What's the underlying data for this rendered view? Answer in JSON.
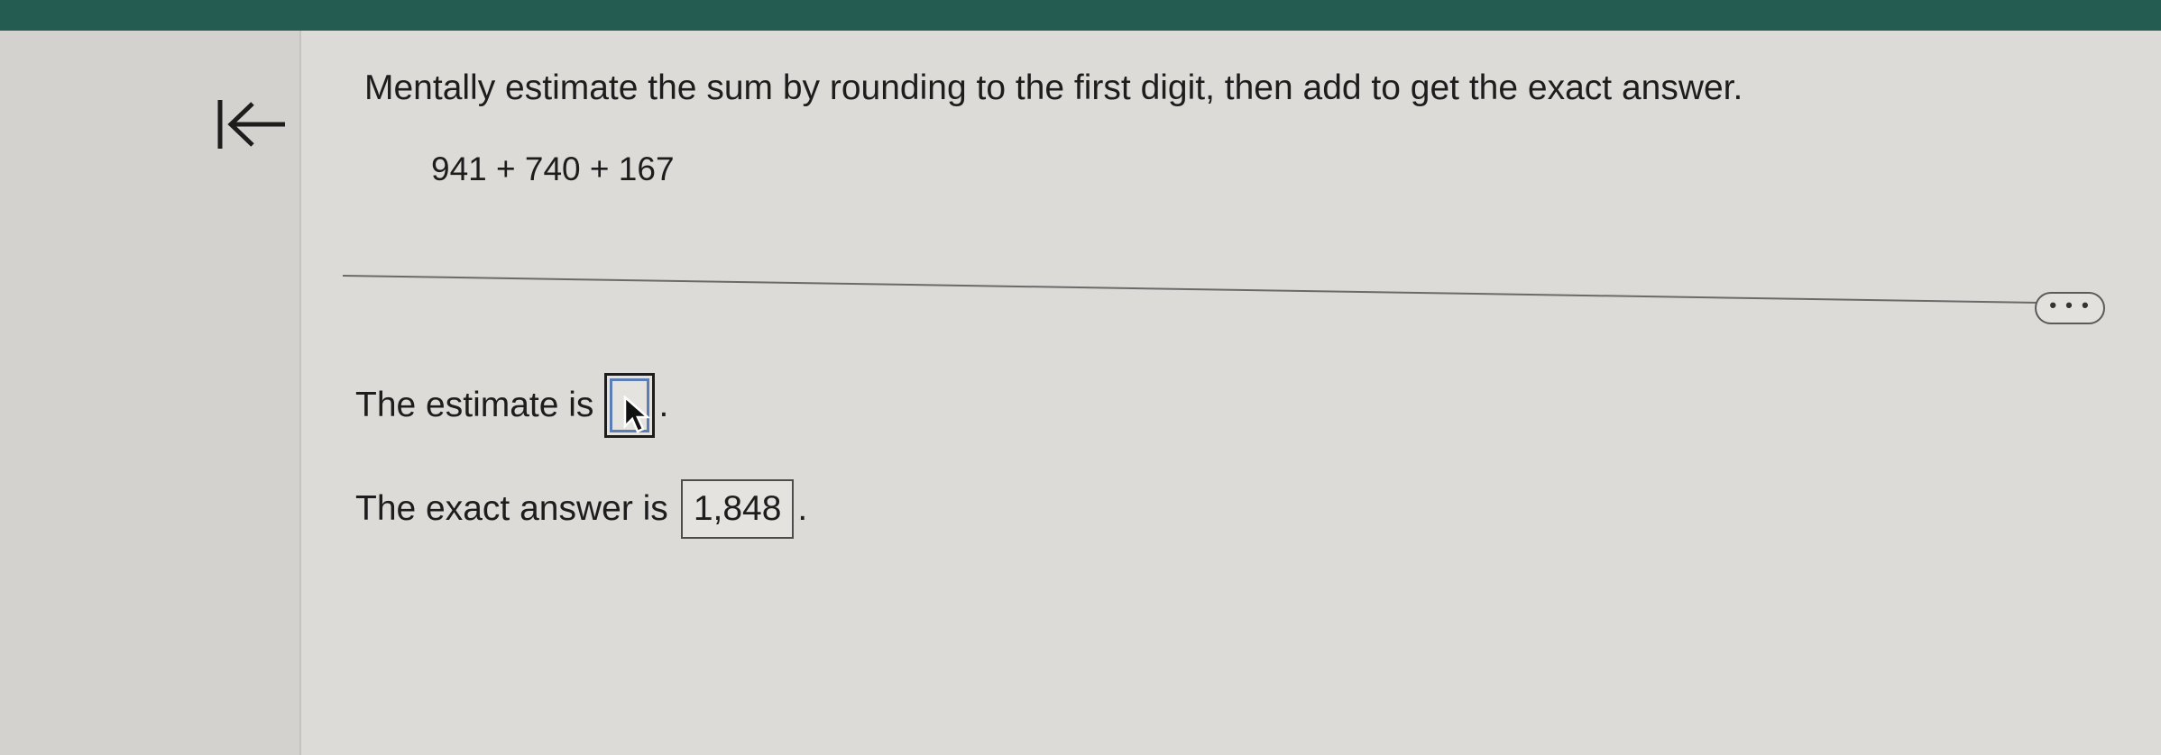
{
  "question": {
    "prompt": "Mentally estimate the sum by rounding to the first digit, then add to get the exact answer.",
    "expression": "941 + 740 + 167"
  },
  "more_button": {
    "label": "• • •"
  },
  "answers": {
    "estimate_label": "The estimate is",
    "estimate_value": "",
    "exact_label": "The exact answer is",
    "exact_value": "1,848",
    "terminator": "."
  },
  "icons": {
    "collapse": "collapse-left-icon",
    "cursor": "mouse-pointer-icon"
  },
  "colors": {
    "header": "#255c52",
    "focus": "#5b7fb5"
  }
}
